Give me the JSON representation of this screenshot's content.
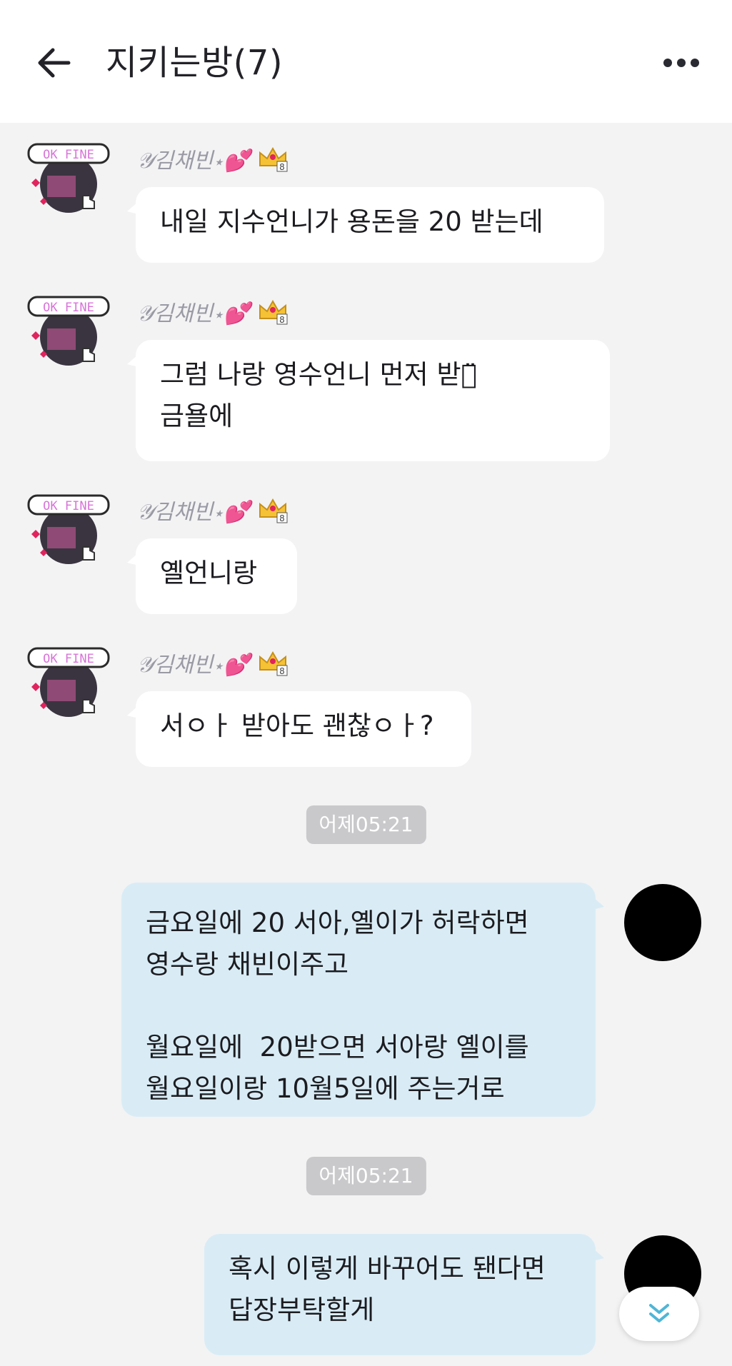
{
  "header": {
    "title": "지키는방(7)"
  },
  "icons": {
    "back": "arrow-left-icon",
    "more": "more-dots-icon",
    "scroll": "double-chevron-down-icon"
  },
  "colors": {
    "incoming_bubble": "#ffffff",
    "outgoing_bubble": "#d9ecf6",
    "background": "#f3f3f4",
    "time_pill": "#c9c9cc",
    "scroll_chevron": "#4fb6d6"
  },
  "sender": {
    "name": "𝒴김채빈⋆💕",
    "avatar_badge": "OK FINE"
  },
  "incoming": [
    {
      "text": "내일 지수언니가 용돈을 20 받는데"
    },
    {
      "text": "그럼 나랑 영수언니 먼저 받고̈\n금욜에"
    },
    {
      "text": "옐언니랑"
    },
    {
      "text": "서ㅇㅏ 받아도 괜찮ㅇㅏ?"
    }
  ],
  "times": [
    "어제05:21",
    "어제05:21"
  ],
  "outgoing": [
    {
      "text": "금요일에 20 서아,옐이가 허락하면\n영수랑 채빈이주고\n\n월요일에  20받으면 서아랑 옐이를\n월요일이랑 10월5일에 주는거로"
    },
    {
      "text": "혹시 이렇게 바꾸어도 됀다면\n답장부탁할게"
    }
  ]
}
